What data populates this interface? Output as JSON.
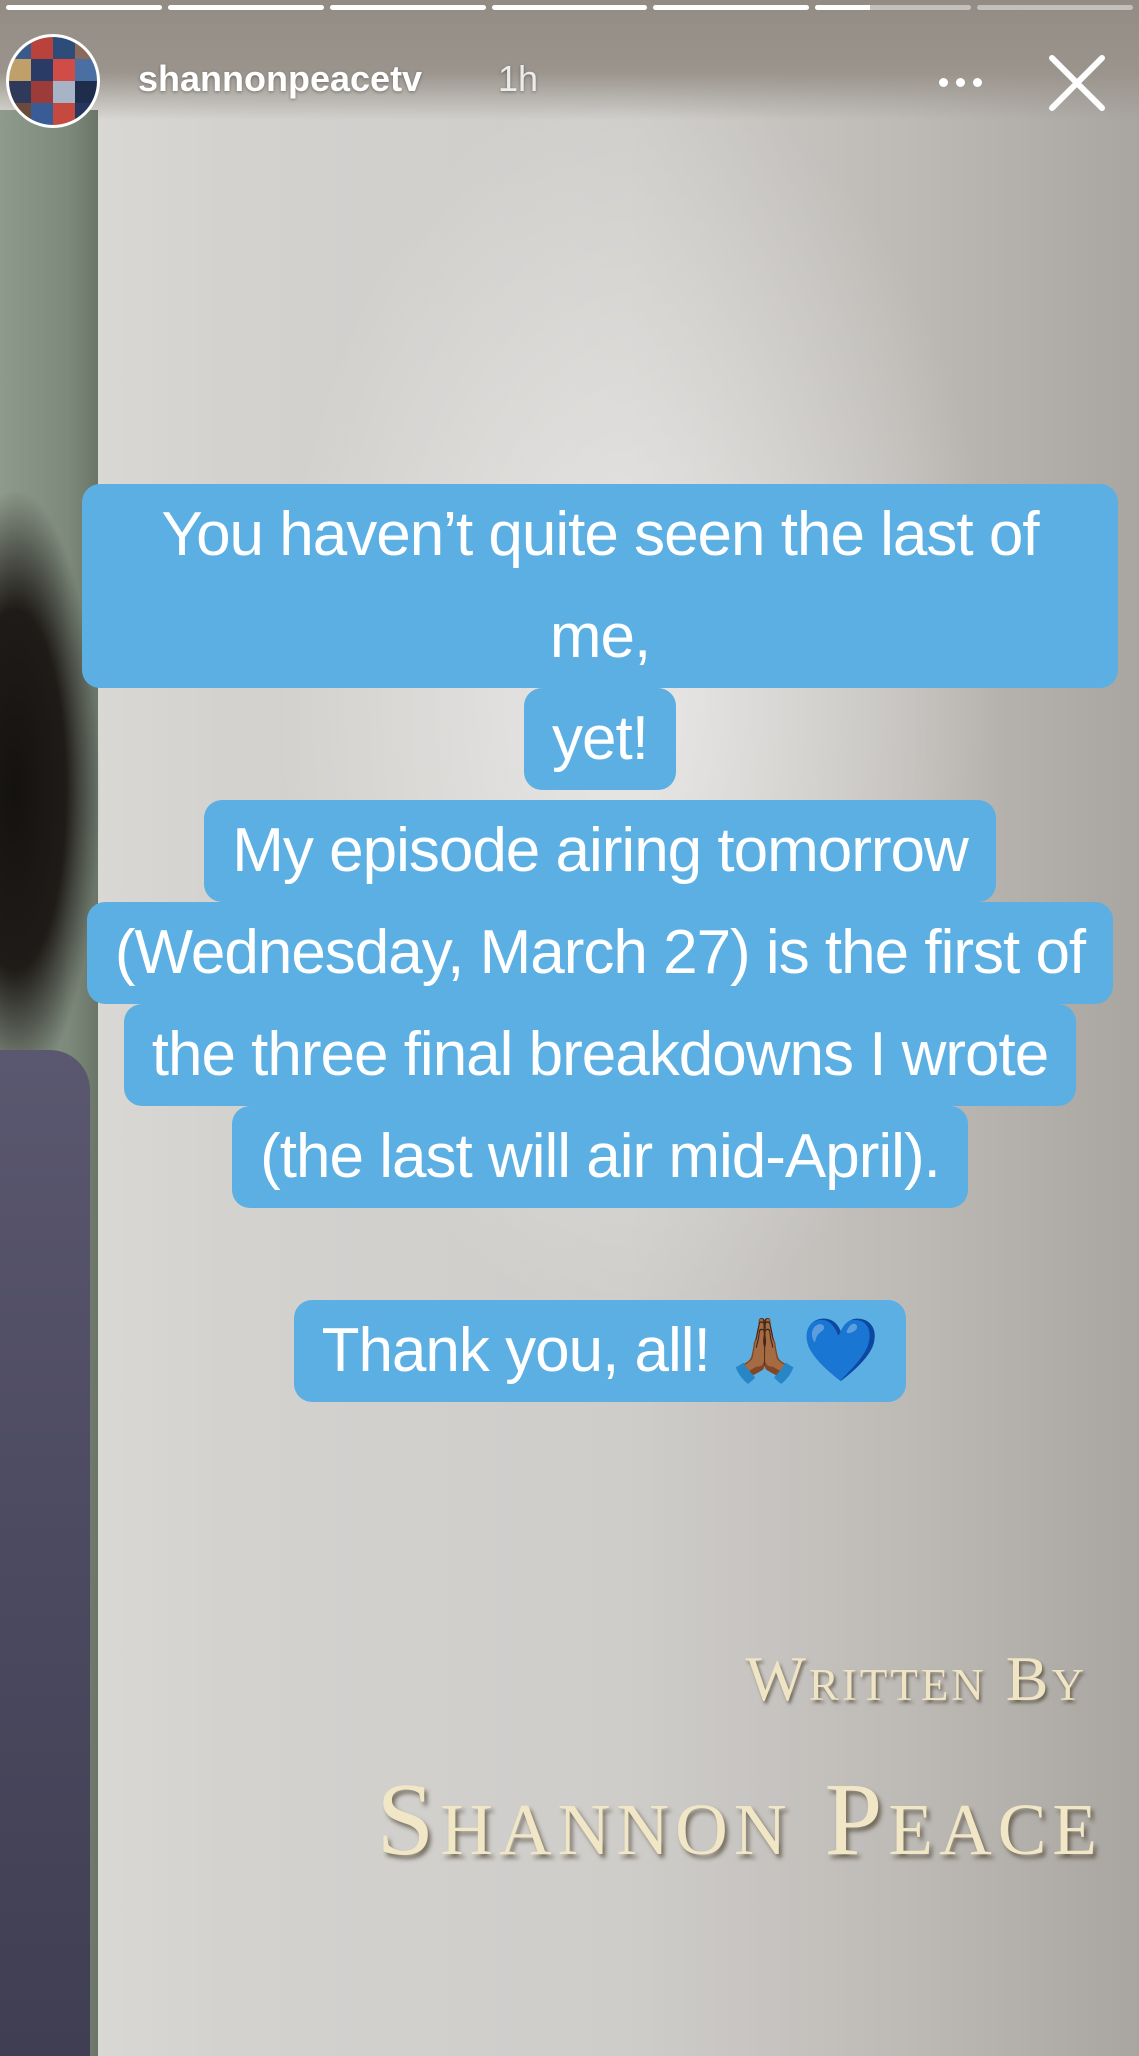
{
  "story": {
    "progress_segments": [
      1,
      1,
      1,
      1,
      1,
      0.35,
      0
    ],
    "username": "shannonpeacetv",
    "timestamp": "1h",
    "more_icon": "more-horizontal-icon",
    "close_icon": "close-icon"
  },
  "caption": {
    "block1": [
      "You haven’t quite seen the last of me,",
      "yet!"
    ],
    "block2": [
      "My episode airing tomorrow",
      "(Wednesday, March 27) is the first of",
      "the three final breakdowns I wrote",
      "(the last will air mid-April)."
    ],
    "block3": "Thank you, all! 🙏🏾💙",
    "bubble_color": "#5bafe3"
  },
  "video_frame": {
    "credit_heading": "Written By",
    "credit_name": "Shannon Peace"
  }
}
